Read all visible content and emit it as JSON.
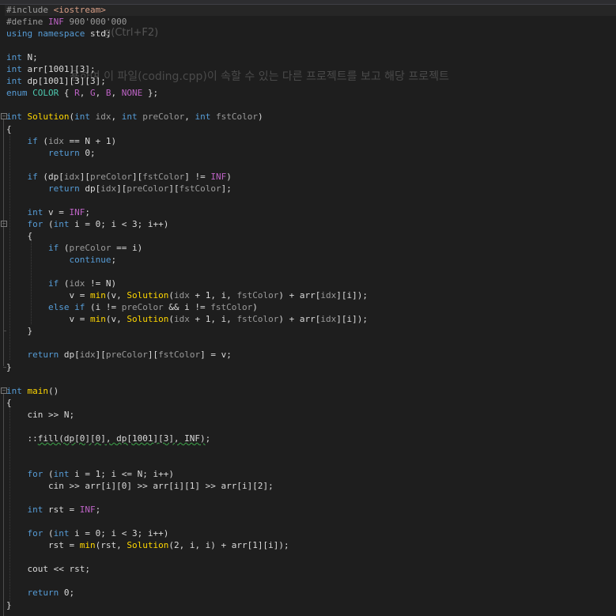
{
  "editor": {
    "ghost_hint": "g(Ctrl+F2)",
    "ghost_description": "용하여 이 파일(coding.cpp)이 속할 수 있는 다른 프로젝트를 보고 해당 프로젝트",
    "colors": {
      "background": "#1e1e1e",
      "keyword": "#569cd6",
      "function": "#ffd700",
      "macro": "#bd63c5",
      "type": "#4ec9b0",
      "parameter": "#9a9a9a",
      "include_string": "#d69d85"
    },
    "icons": [
      "fold-collapse-icon"
    ]
  },
  "code": {
    "lines": [
      [
        [
          "pp",
          "#include "
        ],
        [
          "str",
          "<iostream>"
        ]
      ],
      [
        [
          "pp",
          "#define "
        ],
        [
          "mac",
          "INF"
        ],
        [
          "pp",
          " 900'000'000"
        ]
      ],
      [
        [
          "kw",
          "using"
        ],
        [
          "gv",
          " "
        ],
        [
          "kw",
          "namespace"
        ],
        [
          "gv",
          " std;"
        ]
      ],
      [],
      [
        [
          "kw",
          "int"
        ],
        [
          "gv",
          " N;"
        ]
      ],
      [
        [
          "kw",
          "int"
        ],
        [
          "gv",
          " arr[1001][3];"
        ]
      ],
      [
        [
          "kw",
          "int"
        ],
        [
          "gv",
          " dp[1001][3][3];"
        ]
      ],
      [
        [
          "kw",
          "enum"
        ],
        [
          "gv",
          " "
        ],
        [
          "ty",
          "COLOR"
        ],
        [
          "gv",
          " { "
        ],
        [
          "mac",
          "R"
        ],
        [
          "gv",
          ", "
        ],
        [
          "mac",
          "G"
        ],
        [
          "gv",
          ", "
        ],
        [
          "mac",
          "B"
        ],
        [
          "gv",
          ", "
        ],
        [
          "mac",
          "NONE"
        ],
        [
          "gv",
          " };"
        ]
      ],
      [],
      [
        [
          "kw",
          "int"
        ],
        [
          "gv",
          " "
        ],
        [
          "fn",
          "Solution"
        ],
        [
          "gv",
          "("
        ],
        [
          "kw",
          "int"
        ],
        [
          "gv",
          " "
        ],
        [
          "pm",
          "idx"
        ],
        [
          "gv",
          ", "
        ],
        [
          "kw",
          "int"
        ],
        [
          "gv",
          " "
        ],
        [
          "pm",
          "preColor"
        ],
        [
          "gv",
          ", "
        ],
        [
          "kw",
          "int"
        ],
        [
          "gv",
          " "
        ],
        [
          "pm",
          "fstColor"
        ],
        [
          "gv",
          ")"
        ]
      ],
      [
        [
          "gv",
          "{"
        ]
      ],
      [
        [
          "gv",
          "    "
        ],
        [
          "kw",
          "if"
        ],
        [
          "gv",
          " ("
        ],
        [
          "pm",
          "idx"
        ],
        [
          "gv",
          " == N + 1)"
        ]
      ],
      [
        [
          "gv",
          "        "
        ],
        [
          "kw",
          "return"
        ],
        [
          "gv",
          " 0;"
        ]
      ],
      [],
      [
        [
          "gv",
          "    "
        ],
        [
          "kw",
          "if"
        ],
        [
          "gv",
          " (dp["
        ],
        [
          "pm",
          "idx"
        ],
        [
          "gv",
          "]["
        ],
        [
          "pm",
          "preColor"
        ],
        [
          "gv",
          "]["
        ],
        [
          "pm",
          "fstColor"
        ],
        [
          "gv",
          "] != "
        ],
        [
          "mac",
          "INF"
        ],
        [
          "gv",
          ")"
        ]
      ],
      [
        [
          "gv",
          "        "
        ],
        [
          "kw",
          "return"
        ],
        [
          "gv",
          " dp["
        ],
        [
          "pm",
          "idx"
        ],
        [
          "gv",
          "]["
        ],
        [
          "pm",
          "preColor"
        ],
        [
          "gv",
          "]["
        ],
        [
          "pm",
          "fstColor"
        ],
        [
          "gv",
          "];"
        ]
      ],
      [],
      [
        [
          "gv",
          "    "
        ],
        [
          "kw",
          "int"
        ],
        [
          "gv",
          " v = "
        ],
        [
          "mac",
          "INF"
        ],
        [
          "gv",
          ";"
        ]
      ],
      [
        [
          "gv",
          "    "
        ],
        [
          "kw",
          "for"
        ],
        [
          "gv",
          " ("
        ],
        [
          "kw",
          "int"
        ],
        [
          "gv",
          " i = 0; i < 3; i++)"
        ]
      ],
      [
        [
          "gv",
          "    {"
        ]
      ],
      [
        [
          "gv",
          "        "
        ],
        [
          "kw",
          "if"
        ],
        [
          "gv",
          " ("
        ],
        [
          "pm",
          "preColor"
        ],
        [
          "gv",
          " == i)"
        ]
      ],
      [
        [
          "gv",
          "            "
        ],
        [
          "kw",
          "continue"
        ],
        [
          "gv",
          ";"
        ]
      ],
      [],
      [
        [
          "gv",
          "        "
        ],
        [
          "kw",
          "if"
        ],
        [
          "gv",
          " ("
        ],
        [
          "pm",
          "idx"
        ],
        [
          "gv",
          " != N)"
        ]
      ],
      [
        [
          "gv",
          "            v = "
        ],
        [
          "fn",
          "min"
        ],
        [
          "gv",
          "(v, "
        ],
        [
          "fn",
          "Solution"
        ],
        [
          "gv",
          "("
        ],
        [
          "pm",
          "idx"
        ],
        [
          "gv",
          " + 1, i, "
        ],
        [
          "pm",
          "fstColor"
        ],
        [
          "gv",
          ") + arr["
        ],
        [
          "pm",
          "idx"
        ],
        [
          "gv",
          "][i]);"
        ]
      ],
      [
        [
          "gv",
          "        "
        ],
        [
          "kw",
          "else if"
        ],
        [
          "gv",
          " (i != "
        ],
        [
          "pm",
          "preColor"
        ],
        [
          "gv",
          " && i != "
        ],
        [
          "pm",
          "fstColor"
        ],
        [
          "gv",
          ")"
        ]
      ],
      [
        [
          "gv",
          "            v = "
        ],
        [
          "fn",
          "min"
        ],
        [
          "gv",
          "(v, "
        ],
        [
          "fn",
          "Solution"
        ],
        [
          "gv",
          "("
        ],
        [
          "pm",
          "idx"
        ],
        [
          "gv",
          " + 1, i, "
        ],
        [
          "pm",
          "fstColor"
        ],
        [
          "gv",
          ") + arr["
        ],
        [
          "pm",
          "idx"
        ],
        [
          "gv",
          "][i]);"
        ]
      ],
      [
        [
          "gv",
          "    }"
        ]
      ],
      [],
      [
        [
          "gv",
          "    "
        ],
        [
          "kw",
          "return"
        ],
        [
          "gv",
          " dp["
        ],
        [
          "pm",
          "idx"
        ],
        [
          "gv",
          "]["
        ],
        [
          "pm",
          "preColor"
        ],
        [
          "gv",
          "]["
        ],
        [
          "pm",
          "fstColor"
        ],
        [
          "gv",
          "] = v;"
        ]
      ],
      [
        [
          "gv",
          "}"
        ]
      ],
      [],
      [
        [
          "kw",
          "int"
        ],
        [
          "gv",
          " "
        ],
        [
          "fn",
          "main"
        ],
        [
          "gv",
          "()"
        ]
      ],
      [
        [
          "gv",
          "{"
        ]
      ],
      [
        [
          "gv",
          "    cin >> N;"
        ]
      ],
      [],
      [
        [
          "gv",
          "    ::"
        ],
        [
          "sq",
          "fill(dp[0][0], dp[1001][3], INF)"
        ],
        [
          "gv",
          ";"
        ]
      ],
      [],
      [],
      [
        [
          "gv",
          "    "
        ],
        [
          "kw",
          "for"
        ],
        [
          "gv",
          " ("
        ],
        [
          "kw",
          "int"
        ],
        [
          "gv",
          " i = 1; i <= N; i++)"
        ]
      ],
      [
        [
          "gv",
          "        cin >> arr[i][0] >> arr[i][1] >> arr[i][2];"
        ]
      ],
      [],
      [
        [
          "gv",
          "    "
        ],
        [
          "kw",
          "int"
        ],
        [
          "gv",
          " rst = "
        ],
        [
          "mac",
          "INF"
        ],
        [
          "gv",
          ";"
        ]
      ],
      [],
      [
        [
          "gv",
          "    "
        ],
        [
          "kw",
          "for"
        ],
        [
          "gv",
          " ("
        ],
        [
          "kw",
          "int"
        ],
        [
          "gv",
          " i = 0; i < 3; i++)"
        ]
      ],
      [
        [
          "gv",
          "        rst = "
        ],
        [
          "fn",
          "min"
        ],
        [
          "gv",
          "(rst, "
        ],
        [
          "fn",
          "Solution"
        ],
        [
          "gv",
          "(2, i, i) + arr[1][i]);"
        ]
      ],
      [],
      [
        [
          "gv",
          "    cout << rst;"
        ]
      ],
      [],
      [
        [
          "gv",
          "    "
        ],
        [
          "kw",
          "return"
        ],
        [
          "gv",
          " 0;"
        ]
      ],
      [
        [
          "gv",
          "}"
        ]
      ]
    ]
  }
}
